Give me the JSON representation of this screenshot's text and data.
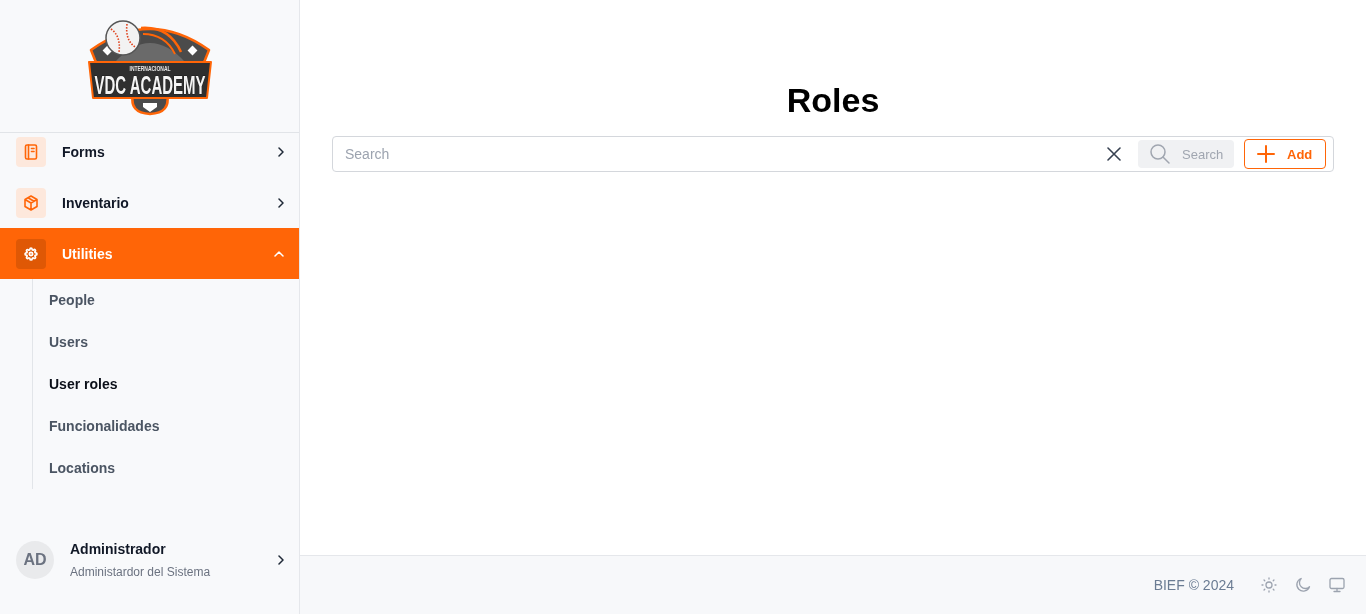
{
  "sidebar": {
    "logo": {
      "title": "VDC ACADEMY",
      "subtitle": "INTERNACIONAL"
    },
    "menu": [
      {
        "label": "Forms",
        "selected": false,
        "expanded": false
      },
      {
        "label": "Inventario",
        "selected": false,
        "expanded": false
      },
      {
        "label": "Utilities",
        "selected": true,
        "expanded": true,
        "children": [
          {
            "label": "People",
            "selected": false
          },
          {
            "label": "Users",
            "selected": false
          },
          {
            "label": "User roles",
            "selected": true
          },
          {
            "label": "Funcionalidades",
            "selected": false
          },
          {
            "label": "Locations",
            "selected": false
          }
        ]
      }
    ],
    "user": {
      "initials": "AD",
      "name": "Administrador",
      "role": "Administardor del Sistema"
    }
  },
  "page": {
    "title": "Roles"
  },
  "toolbar": {
    "search": {
      "placeholder": "Search"
    },
    "search_button": "Search",
    "add_button": "Add"
  },
  "footer": {
    "copyright": "BIEF © 2024"
  }
}
